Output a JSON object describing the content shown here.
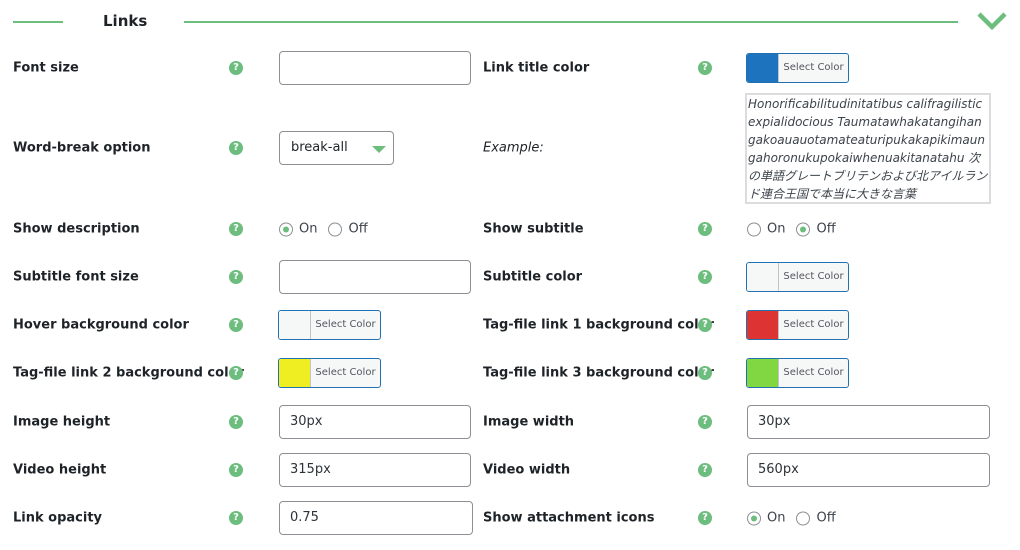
{
  "section": {
    "title": "Links",
    "accent": "#6cbd7e"
  },
  "help_glyph": "?",
  "left": [
    {
      "label": "Font size",
      "type": "text",
      "value": ""
    },
    {
      "label": "Word-break option",
      "type": "select",
      "value": "break-all"
    },
    {
      "label": "Show description",
      "type": "radio",
      "options": [
        "On",
        "Off"
      ],
      "selected": "On"
    },
    {
      "label": "Subtitle font size",
      "type": "text",
      "value": ""
    },
    {
      "label": "Hover background color",
      "type": "color",
      "button": "Select Color",
      "color": "#f6f7f7"
    },
    {
      "label": "Tag-file link 2 background color",
      "type": "color",
      "button": "Select Color",
      "color": "#eeee22"
    },
    {
      "label": "Image height",
      "type": "text",
      "value": "30px"
    },
    {
      "label": "Video height",
      "type": "text",
      "value": "315px"
    },
    {
      "label": "Link opacity",
      "type": "text",
      "value": "0.75"
    }
  ],
  "right": [
    {
      "label": "Link title color",
      "type": "color",
      "button": "Select Color",
      "color": "#1e73be"
    },
    {
      "label": "Example:",
      "type": "example",
      "text": "Honorificabilitudinitatibus califragilistic expialidocious Taumatawhakatangihangakoauauotamateaturipukakapikimaungahoronukupokaiwhenuakitanatahu 次の単語グレートブリテンおよび北アイルランド連合王国で本当に大きな言葉"
    },
    {
      "label": "Show subtitle",
      "type": "radio",
      "options": [
        "On",
        "Off"
      ],
      "selected": "Off"
    },
    {
      "label": "Subtitle color",
      "type": "color",
      "button": "Select Color",
      "color": "#f6f7f7"
    },
    {
      "label": "Tag-file link 1 background color",
      "type": "color",
      "button": "Select Color",
      "color": "#dd3333"
    },
    {
      "label": "Tag-file link 3 background color",
      "type": "color",
      "button": "Select Color",
      "color": "#81d742"
    },
    {
      "label": "Image width",
      "type": "text",
      "value": "30px"
    },
    {
      "label": "Video width",
      "type": "text",
      "value": "560px"
    },
    {
      "label": "Show attachment icons",
      "type": "radio",
      "options": [
        "On",
        "Off"
      ],
      "selected": "On"
    }
  ]
}
